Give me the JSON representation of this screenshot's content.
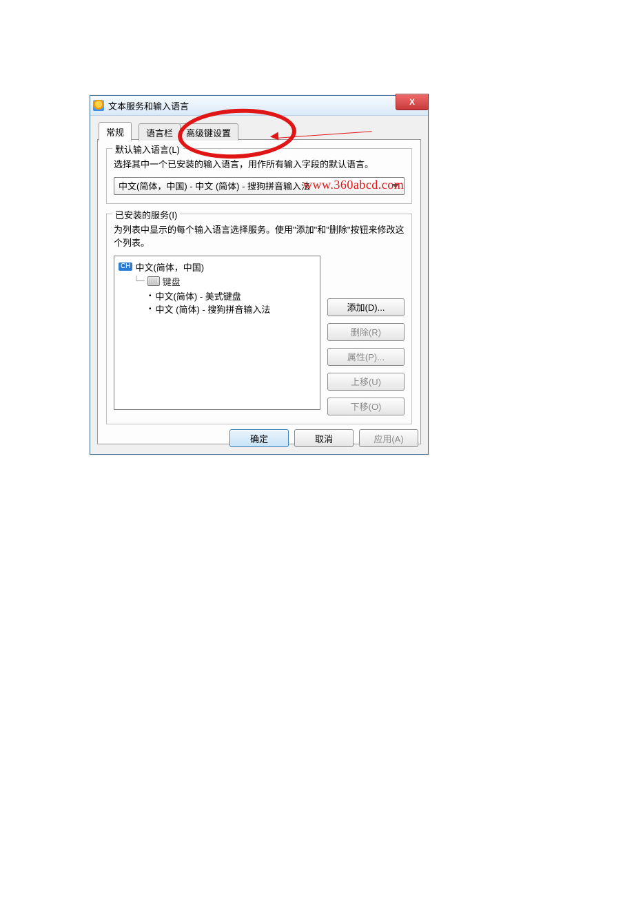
{
  "window": {
    "title": "文本服务和输入语言",
    "close_x": "X"
  },
  "tabs": {
    "general": "常规",
    "language_bar": "语言栏",
    "advanced_keys": "高级键设置"
  },
  "group_default": {
    "legend": "默认输入语言(L)",
    "desc": "选择其中一个已安装的输入语言，用作所有输入字段的默认语言。",
    "combo_value": "中文(简体，中国) - 中文 (简体) - 搜狗拼音输入法"
  },
  "group_services": {
    "legend": "已安装的服务(I)",
    "desc": "为列表中显示的每个输入语言选择服务。使用\"添加\"和\"删除\"按钮来修改这个列表。",
    "tree": {
      "lang_badge": "CH",
      "lang_label": "中文(简体，中国)",
      "keyboard_label": "键盘",
      "item1": "中文(简体) - 美式键盘",
      "item2": "中文 (简体) - 搜狗拼音输入法"
    },
    "buttons": {
      "add": "添加(D)...",
      "remove": "删除(R)",
      "properties": "属性(P)...",
      "move_up": "上移(U)",
      "move_down": "下移(O)"
    }
  },
  "dialog_buttons": {
    "ok": "确定",
    "cancel": "取消",
    "apply": "应用(A)"
  },
  "annotation": {
    "watermark": "www.360abcd.com"
  }
}
